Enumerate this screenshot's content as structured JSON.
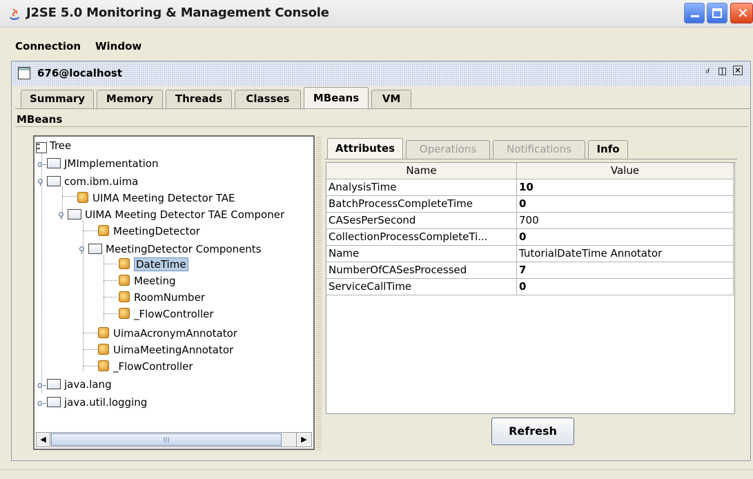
{
  "window": {
    "title": "J2SE 5.0 Monitoring & Management Console",
    "controls": [
      "minimize-icon",
      "maximize-icon",
      "close-icon"
    ]
  },
  "menu": [
    "Connection",
    "Window"
  ],
  "frame": {
    "title": "676@localhost",
    "controls": [
      "minimize-frame-icon",
      "restore-frame-icon",
      "close-frame-icon"
    ]
  },
  "tabs": [
    "Summary",
    "Memory",
    "Threads",
    "Classes",
    "MBeans",
    "VM"
  ],
  "selected_tab": "MBeans",
  "section_label": "MBeans",
  "tree": {
    "root": "Tree",
    "nodes": [
      {
        "label": "JMImplementation",
        "type": "folder",
        "expanded": false
      },
      {
        "label": "com.ibm.uima",
        "type": "folder",
        "expanded": true
      },
      {
        "label": "UIMA Meeting Detector TAE",
        "type": "bean"
      },
      {
        "label": "UIMA Meeting Detector TAE Componer",
        "type": "folder",
        "expanded": true
      },
      {
        "label": "MeetingDetector",
        "type": "bean"
      },
      {
        "label": "MeetingDetector Components",
        "type": "folder",
        "expanded": true
      },
      {
        "label": "DateTime",
        "type": "bean",
        "selected": true
      },
      {
        "label": "Meeting",
        "type": "bean"
      },
      {
        "label": "RoomNumber",
        "type": "bean"
      },
      {
        "label": "_FlowController",
        "type": "bean"
      },
      {
        "label": "UimaAcronymAnnotator",
        "type": "bean"
      },
      {
        "label": "UimaMeetingAnnotator",
        "type": "bean"
      },
      {
        "label": "_FlowController",
        "type": "bean"
      },
      {
        "label": "java.lang",
        "type": "folder",
        "expanded": false
      },
      {
        "label": "java.util.logging",
        "type": "folder",
        "expanded": false
      }
    ]
  },
  "scrollbar": {
    "thumb_glyph": "III"
  },
  "detail_tabs": [
    {
      "label": "Attributes",
      "state": "selected"
    },
    {
      "label": "Operations",
      "state": "disabled"
    },
    {
      "label": "Notifications",
      "state": "disabled"
    },
    {
      "label": "Info",
      "state": "enabled"
    }
  ],
  "attributes": {
    "columns": [
      "Name",
      "Value"
    ],
    "rows": [
      {
        "name": "AnalysisTime",
        "value": "10",
        "bold": true
      },
      {
        "name": "BatchProcessCompleteTime",
        "value": "0",
        "bold": true
      },
      {
        "name": "CASesPerSecond",
        "value": "700",
        "bold": false
      },
      {
        "name": "CollectionProcessCompleteTi...",
        "value": "0",
        "bold": true
      },
      {
        "name": "Name",
        "value": "TutorialDateTime Annotator",
        "bold": false
      },
      {
        "name": "NumberOfCASesProcessed",
        "value": "7",
        "bold": true
      },
      {
        "name": "ServiceCallTime",
        "value": "0",
        "bold": true
      }
    ]
  },
  "refresh_label": "Refresh"
}
